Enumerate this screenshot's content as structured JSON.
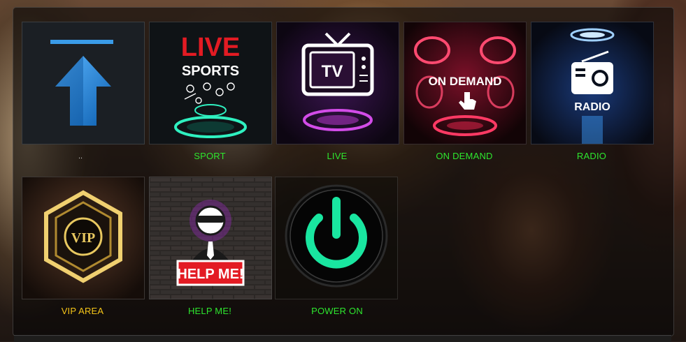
{
  "menu": {
    "up_label": "..",
    "items": [
      {
        "label": "SPORT",
        "art_text": [
          "LIVE",
          "SPORTS"
        ]
      },
      {
        "label": "LIVE",
        "art_text": [
          "TV"
        ]
      },
      {
        "label": "ON DEMAND",
        "art_text": [
          "ON DEMAND"
        ]
      },
      {
        "label": "RADIO",
        "art_text": [
          "RADIO"
        ]
      },
      {
        "label": "VIP AREA",
        "art_text": [
          "VIP"
        ]
      },
      {
        "label": "HELP ME!",
        "art_text": [
          "HELP ME!"
        ]
      },
      {
        "label": "POWER ON",
        "art_text": []
      }
    ]
  },
  "colors": {
    "label_green": "#2ee62e",
    "label_gold": "#f5c518",
    "up_arrow_blue": "#1f8ae0",
    "sports_red": "#e31b23",
    "tv_purple": "#c13cd8",
    "ondemand_red": "#e0244a",
    "radio_blue": "#3fa0ff",
    "vip_gold": "#d8b040",
    "power_green": "#19e6a0"
  },
  "icons": [
    "up-arrow-icon",
    "live-sports-art",
    "tv-icon",
    "on-demand-art",
    "radio-icon",
    "vip-badge",
    "help-me-art",
    "power-icon"
  ]
}
